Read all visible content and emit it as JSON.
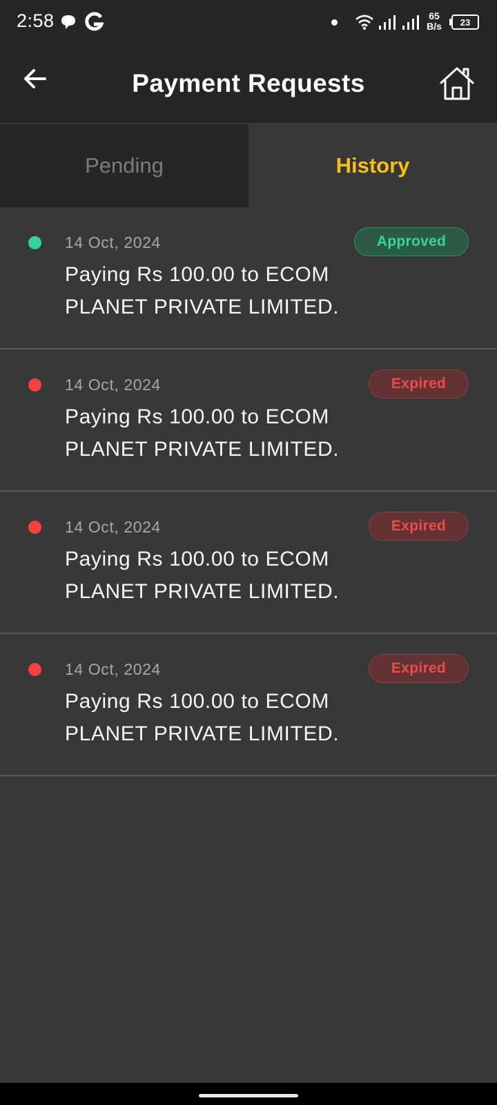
{
  "status_bar": {
    "time": "2:58",
    "net_speed_value": "65",
    "net_speed_unit": "B/s",
    "battery": "23",
    "icons": [
      "chat-icon",
      "google-icon",
      "dot-icon",
      "wifi-icon",
      "signal-icon",
      "signal-icon",
      "battery-icon"
    ]
  },
  "header": {
    "title": "Payment Requests",
    "back_icon": "arrow-left-icon",
    "home_icon": "home-icon"
  },
  "tabs": [
    {
      "label": "Pending",
      "selected": false
    },
    {
      "label": "History",
      "selected": true
    }
  ],
  "colors": {
    "accent": "#fbbd18",
    "approved_text": "#3cd39a",
    "approved_bg": "#2a5a48",
    "expired_text": "#ef4b4b",
    "expired_bg": "#633333",
    "dot_green": "#34d399",
    "dot_red": "#f44242"
  },
  "requests": [
    {
      "date": "14 Oct, 2024",
      "status": "Approved",
      "line1": "Paying Rs 100.00 to ECOM",
      "line2": "PLANET PRIVATE LIMITED."
    },
    {
      "date": "14 Oct, 2024",
      "status": "Expired",
      "line1": "Paying Rs 100.00 to ECOM",
      "line2": "PLANET PRIVATE LIMITED."
    },
    {
      "date": "14 Oct, 2024",
      "status": "Expired",
      "line1": "Paying Rs 100.00 to ECOM",
      "line2": "PLANET PRIVATE LIMITED."
    },
    {
      "date": "14 Oct, 2024",
      "status": "Expired",
      "line1": "Paying Rs 100.00 to ECOM",
      "line2": "PLANET PRIVATE LIMITED."
    }
  ]
}
